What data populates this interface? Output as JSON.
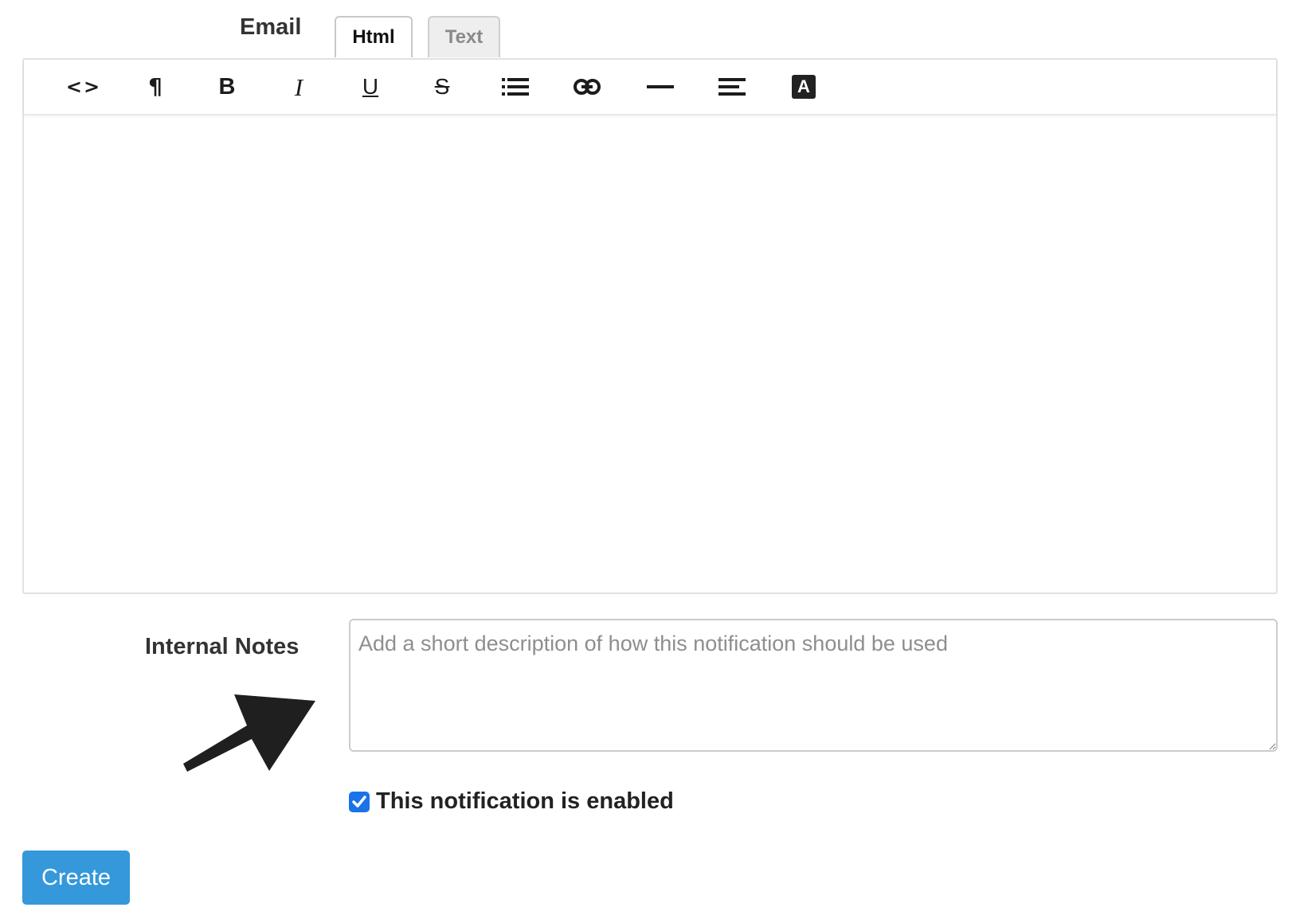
{
  "email": {
    "label": "Email",
    "tabs": [
      {
        "label": "Html",
        "active": true
      },
      {
        "label": "Text",
        "active": false
      }
    ]
  },
  "toolbar": {
    "buttons": [
      {
        "icon": "code-view-icon",
        "glyph": "<>"
      },
      {
        "icon": "paragraph-icon",
        "glyph": "¶"
      },
      {
        "icon": "bold-icon",
        "glyph": "B"
      },
      {
        "icon": "italic-icon",
        "glyph": "I"
      },
      {
        "icon": "underline-icon",
        "glyph": "U"
      },
      {
        "icon": "strikethrough-icon",
        "glyph": "S"
      },
      {
        "icon": "bulleted-list-icon",
        "glyph": ""
      },
      {
        "icon": "link-icon",
        "glyph": ""
      },
      {
        "icon": "horizontal-rule-icon",
        "glyph": ""
      },
      {
        "icon": "align-left-icon",
        "glyph": ""
      },
      {
        "icon": "text-color-icon",
        "glyph": "A"
      }
    ]
  },
  "editor": {
    "content": ""
  },
  "notes": {
    "label": "Internal Notes",
    "placeholder": "Add a short description of how this notification should be used",
    "value": ""
  },
  "enabled": {
    "checked": true,
    "label": "This notification is enabled"
  },
  "create_button": {
    "label": "Create"
  },
  "colors": {
    "accent": "#3498db",
    "checkbox": "#1a73e8",
    "text": "#333333",
    "border": "#cccccc"
  }
}
